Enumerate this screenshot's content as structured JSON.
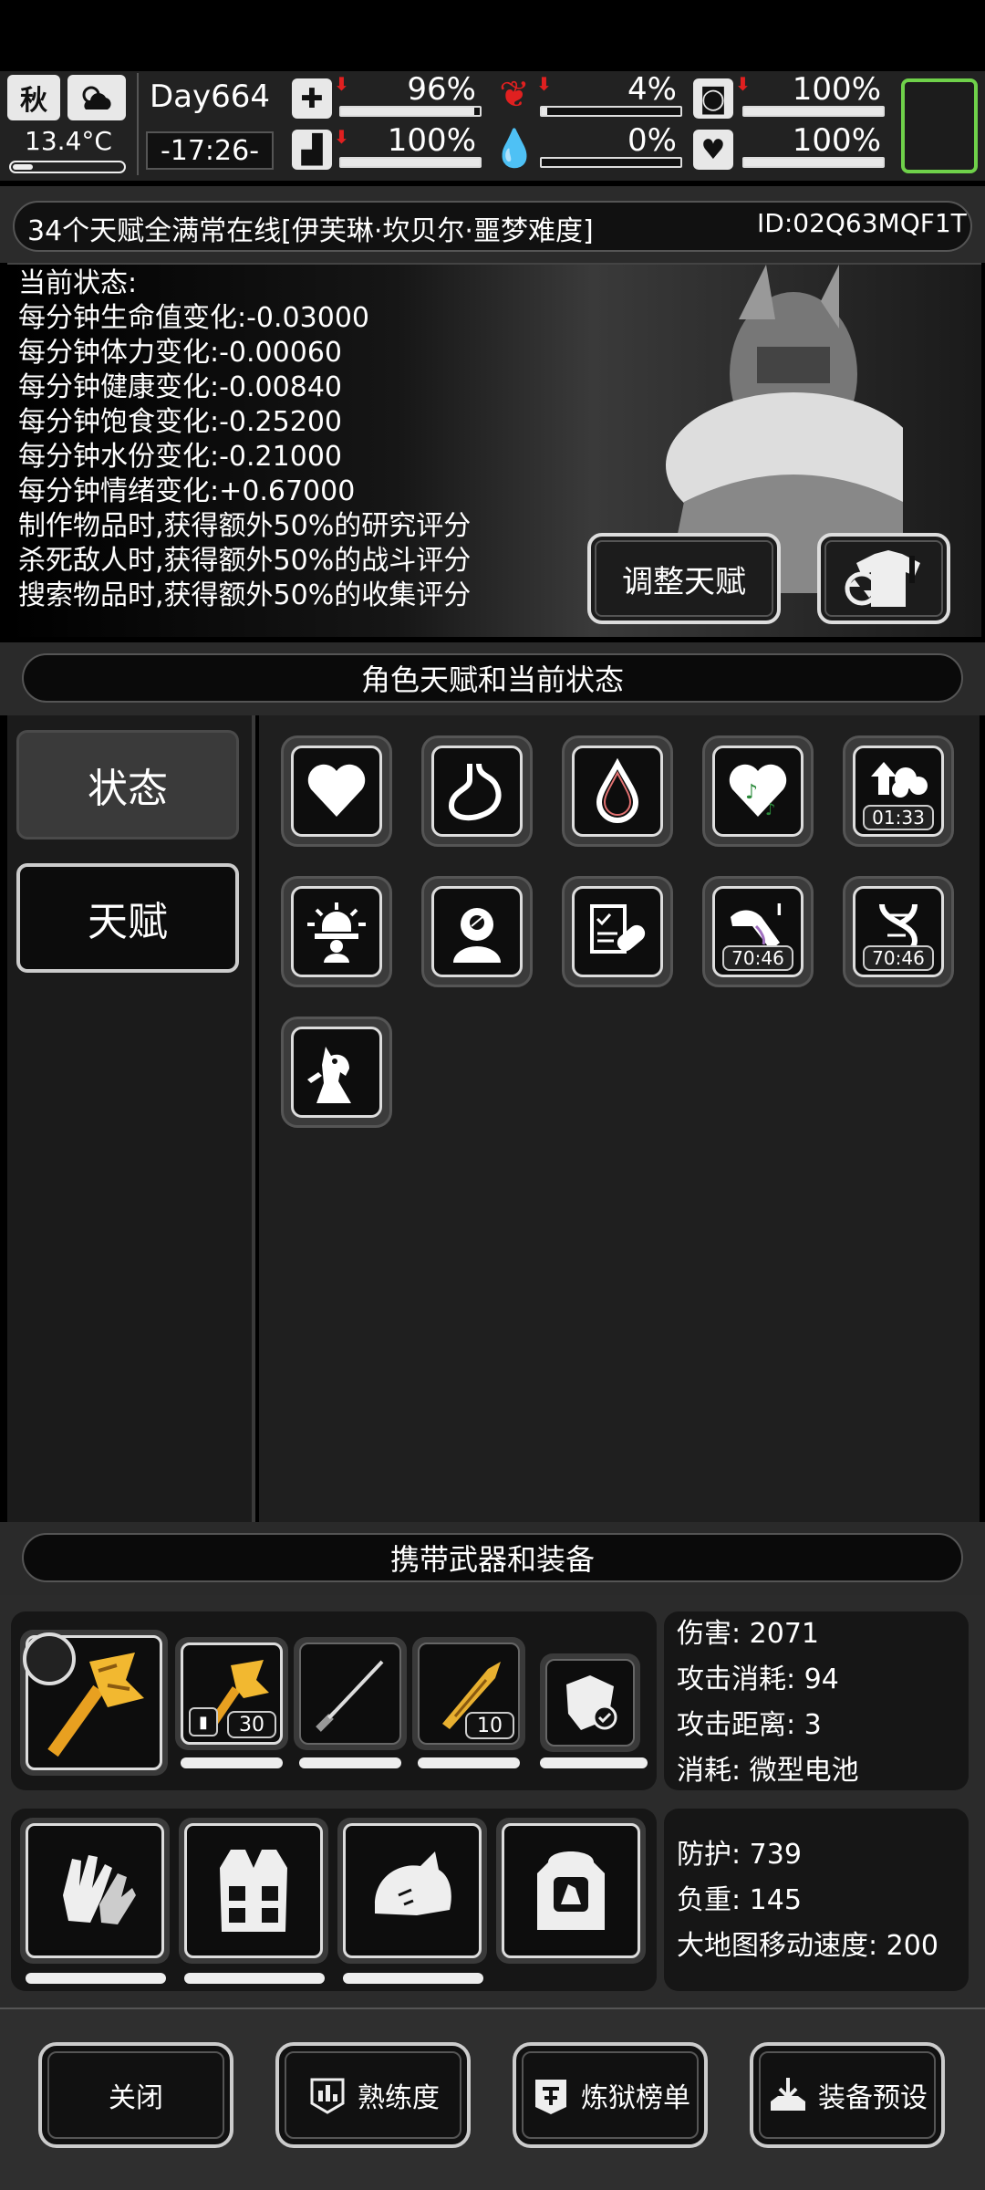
{
  "status_bar": {
    "season": "秋",
    "temperature": "13.4°C",
    "day": "Day664",
    "time": "-17:26-",
    "stats": [
      {
        "name": "health",
        "value": "96%",
        "fill": 0.96
      },
      {
        "name": "hunger",
        "value": "4%",
        "fill": 0.04
      },
      {
        "name": "sanity",
        "value": "100%",
        "fill": 1.0
      },
      {
        "name": "stamina",
        "value": "100%",
        "fill": 1.0
      },
      {
        "name": "thirst",
        "value": "0%",
        "fill": 0.0
      },
      {
        "name": "mood",
        "value": "100%",
        "fill": 1.0
      }
    ]
  },
  "title": "34个天赋全满常在线[伊芙琳·坎贝尔·噩梦难度]",
  "id_label": "ID:02Q63MQF1T",
  "current_state": {
    "heading": "当前状态:",
    "lines": [
      "每分钟生命值变化:-0.03000",
      "每分钟体力变化:-0.00060",
      "每分钟健康变化:-0.00840",
      "每分钟饱食变化:-0.25200",
      "每分钟水份变化:-0.21000",
      "每分钟情绪变化:+0.67000",
      "制作物品时,获得额外50%的研究评分",
      "杀死敌人时,获得额外50%的战斗评分",
      "搜索物品时,获得额外50%的收集评分"
    ],
    "adjust_button": "调整天赋"
  },
  "talent_section_title": "角色天赋和当前状态",
  "tabs": {
    "status": "状态",
    "talent": "天赋"
  },
  "talent_timers": [
    "01:33",
    "70:46",
    "70:46"
  ],
  "equipment_section_title": "携带武器和装备",
  "weapon_stats": {
    "damage": "伤害: 2071",
    "attack_cost": "攻击消耗: 94",
    "attack_range": "攻击距离: 3",
    "consume": "消耗: 微型电池"
  },
  "armor_stats": {
    "defense": "防护: 739",
    "weight": "负重: 145",
    "map_speed": "大地图移动速度: 200"
  },
  "ammo_counts": [
    "30",
    "10"
  ],
  "buttons": {
    "close": "关闭",
    "proficiency": "熟练度",
    "ranking": "炼狱榜单",
    "preset": "装备预设"
  },
  "colors": {
    "accent_green": "#6fd14a",
    "alert_red": "#e02020",
    "gold": "#e8a020"
  }
}
